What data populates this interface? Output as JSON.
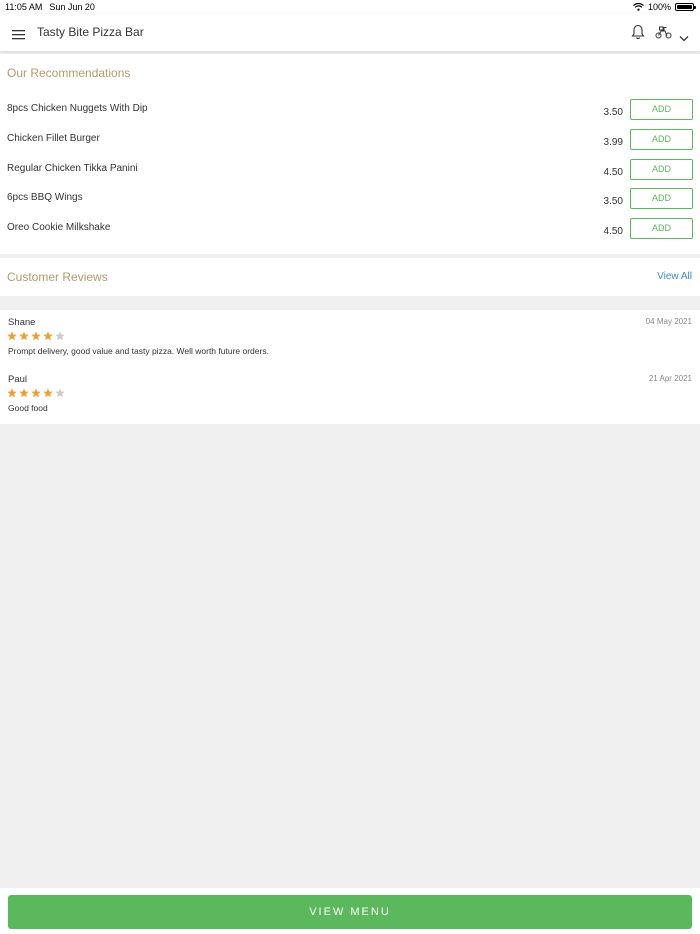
{
  "status_bar": {
    "time": "11:05 AM",
    "date": "Sun Jun 20",
    "battery": "100%"
  },
  "header": {
    "title": "Tasty Bite Pizza Bar",
    "icons": [
      "menu-icon",
      "bell-icon",
      "delivery-scooter-icon",
      "chevron-down-icon"
    ]
  },
  "recommendations": {
    "title": "Our Recommendations",
    "add_label": "ADD",
    "items": [
      {
        "name": "8pcs Chicken Nuggets With Dip",
        "price": "3.50"
      },
      {
        "name": "Chicken Fillet Burger",
        "price": "3.99"
      },
      {
        "name": "Regular Chicken Tikka Panini",
        "price": "4.50"
      },
      {
        "name": "6pcs BBQ Wings",
        "price": "3.50"
      },
      {
        "name": "Oreo Cookie Milkshake",
        "price": "4.50"
      }
    ]
  },
  "reviews": {
    "title": "Customer Reviews",
    "view_all": "View All",
    "items": [
      {
        "name": "Shane",
        "date": "04 May 2021",
        "rating": 4,
        "text": "Prompt delivery, good value and tasty pizza. Well worth future orders."
      },
      {
        "name": "Paul",
        "date": "21 Apr 2021",
        "rating": 4,
        "text": "Good food"
      }
    ]
  },
  "footer": {
    "view_menu_label": "VIEW MENU"
  },
  "colors": {
    "accent_green": "#5cb85c",
    "section_title": "#b59a6e",
    "link_blue": "#3a8bc8",
    "star_filled": "#f0a033",
    "star_empty": "#cccccc"
  }
}
